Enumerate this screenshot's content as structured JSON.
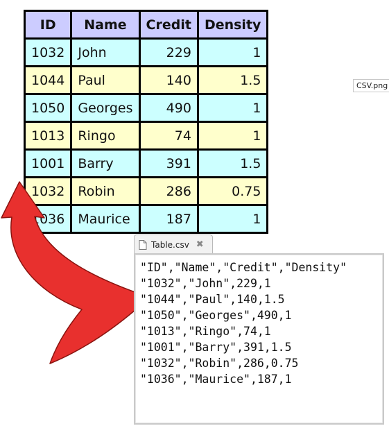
{
  "table": {
    "headers": [
      "ID",
      "Name",
      "Credit",
      "Density"
    ],
    "rows": [
      {
        "id": "1032",
        "name": "John",
        "credit": "229",
        "density": "1"
      },
      {
        "id": "1044",
        "name": "Paul",
        "credit": "140",
        "density": "1.5"
      },
      {
        "id": "1050",
        "name": "Georges",
        "credit": "490",
        "density": "1"
      },
      {
        "id": "1013",
        "name": "Ringo",
        "credit": "74",
        "density": "1"
      },
      {
        "id": "1001",
        "name": "Barry",
        "credit": "391",
        "density": "1.5"
      },
      {
        "id": "1032",
        "name": "Robin",
        "credit": "286",
        "density": "0.75"
      },
      {
        "id": "1036",
        "name": "Maurice",
        "credit": "187",
        "density": "1"
      }
    ]
  },
  "caption": {
    "label": "CSV.png"
  },
  "editor": {
    "tab_label": "Table.csv",
    "tab_icon": "file-icon",
    "close_icon": "close-icon",
    "lines": [
      "\"ID\",\"Name\",\"Credit\",\"Density\"",
      "\"1032\",\"John\",229,1",
      "\"1044\",\"Paul\",140,1.5",
      "\"1050\",\"Georges\",490,1",
      "\"1013\",\"Ringo\",74,1",
      "\"1001\",\"Barry\",391,1.5",
      "\"1032\",\"Robin\",286,0.75",
      "\"1036\",\"Maurice\",187,1"
    ]
  },
  "colors": {
    "header_bg": "#ccccff",
    "row_cyan": "#ccffff",
    "row_yellow": "#ffffcc",
    "arrow_red": "#e8302e"
  }
}
